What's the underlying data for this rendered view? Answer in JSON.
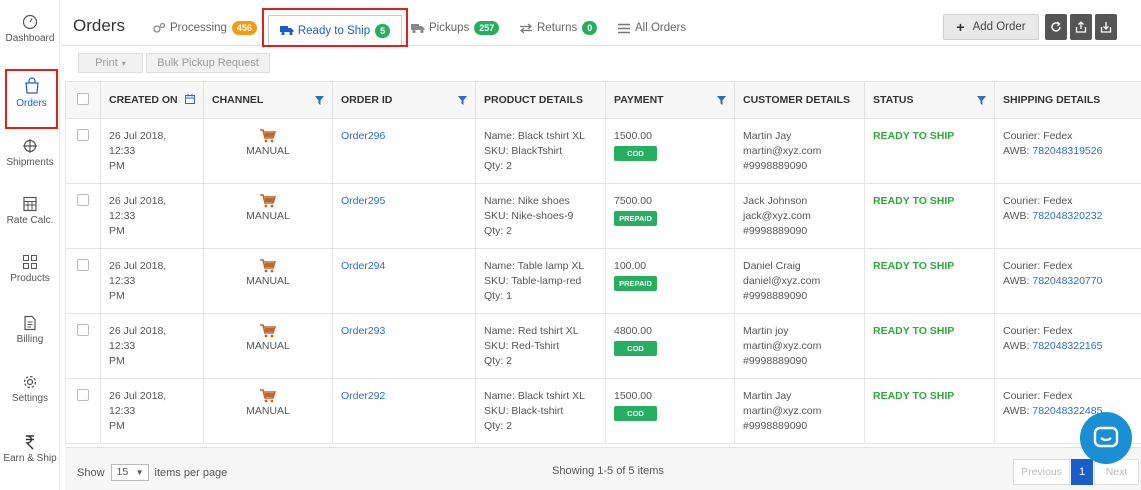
{
  "sidebar": {
    "items": [
      {
        "label": "Dashboard",
        "icon": "dashboard-icon"
      },
      {
        "label": "Orders",
        "icon": "bag-icon"
      },
      {
        "label": "Shipments",
        "icon": "crosshair-icon"
      },
      {
        "label": "Rate Calc.",
        "icon": "calculator-icon"
      },
      {
        "label": "Products",
        "icon": "grid-icon"
      },
      {
        "label": "Billing",
        "icon": "document-icon"
      },
      {
        "label": "Settings",
        "icon": "gear-icon"
      },
      {
        "label": "Earn & Ship",
        "icon": "rupee-icon"
      }
    ]
  },
  "header": {
    "title": "Orders",
    "tabs": [
      {
        "label": "Processing",
        "count": "456",
        "icon": "gears-icon"
      },
      {
        "label": "Ready to Ship",
        "count": "5",
        "icon": "truck-icon"
      },
      {
        "label": "Pickups",
        "count": "257",
        "icon": "truck-icon"
      },
      {
        "label": "Returns",
        "count": "0",
        "icon": "arrows-icon"
      },
      {
        "label": "All Orders",
        "icon": "list-icon"
      }
    ],
    "add_order": "Add Order"
  },
  "toolbar": {
    "print": "Print",
    "bulk_pickup": "Bulk Pickup Request"
  },
  "table": {
    "columns": [
      "CREATED ON",
      "CHANNEL",
      "ORDER ID",
      "PRODUCT DETAILS",
      "PAYMENT",
      "CUSTOMER DETAILS",
      "STATUS",
      "SHIPPING DETAILS"
    ],
    "rows": [
      {
        "date1": "26 Jul 2018, 12:33",
        "date2": "PM",
        "channel": "MANUAL",
        "order_id": "Order296",
        "product_name": "Name: Black tshirt XL",
        "sku": "SKU: BlackTshirt",
        "qty": "Qty: 2",
        "amount": "1500.00",
        "pay_type": "COD",
        "customer_name": "Martin Jay",
        "email": "martin@xyz.com",
        "phone": "#9998889090",
        "status": "READY TO SHIP",
        "courier": "Courier: Fedex",
        "awb_label": "AWB: ",
        "awb": "782048319526"
      },
      {
        "date1": "26 Jul 2018, 12:33",
        "date2": "PM",
        "channel": "MANUAL",
        "order_id": "Order295",
        "product_name": "Name: Nike shoes",
        "sku": "SKU: Nike-shoes-9",
        "qty": "Qty: 2",
        "amount": "7500.00",
        "pay_type": "PREPAID",
        "customer_name": "Jack Johnson",
        "email": "jack@xyz.com",
        "phone": "#9998889090",
        "status": "READY TO SHIP",
        "courier": "Courier: Fedex",
        "awb_label": "AWB: ",
        "awb": "782048320232"
      },
      {
        "date1": "26 Jul 2018, 12:33",
        "date2": "PM",
        "channel": "MANUAL",
        "order_id": "Order294",
        "product_name": "Name: Table lamp XL",
        "sku": "SKU: Table-lamp-red",
        "qty": "Qty: 1",
        "amount": "100.00",
        "pay_type": "PREPAID",
        "customer_name": "Daniel Craig",
        "email": "daniel@xyz.com",
        "phone": "#9998889090",
        "status": "READY TO SHIP",
        "courier": "Courier: Fedex",
        "awb_label": "AWB: ",
        "awb": "782048320770"
      },
      {
        "date1": "26 Jul 2018, 12:33",
        "date2": "PM",
        "channel": "MANUAL",
        "order_id": "Order293",
        "product_name": "Name: Red tshirt XL",
        "sku": "SKU: Red-Tshirt",
        "qty": "Qty: 2",
        "amount": "4800.00",
        "pay_type": "COD",
        "customer_name": "Martin joy",
        "email": "martin@xyz.com",
        "phone": "#9998889090",
        "status": "READY TO SHIP",
        "courier": "Courier: Fedex",
        "awb_label": "AWB: ",
        "awb": "782048322165"
      },
      {
        "date1": "26 Jul 2018, 12:33",
        "date2": "PM",
        "channel": "MANUAL",
        "order_id": "Order292",
        "product_name": "Name: Black tshirt XL",
        "sku": "SKU: Black-tshirt",
        "qty": "Qty: 2",
        "amount": "1500.00",
        "pay_type": "COD",
        "customer_name": "Martin Jay",
        "email": "martin@xyz.com",
        "phone": "#9998889090",
        "status": "READY TO SHIP",
        "courier": "Courier: Fedex",
        "awb_label": "AWB: ",
        "awb": "782048322485"
      }
    ]
  },
  "footer": {
    "show": "Show",
    "per_page": "15",
    "items_per_page": "items per page",
    "showing": "Showing 1-5 of 5 items",
    "previous": "Previous",
    "page": "1",
    "next": "Next"
  },
  "colors": {
    "accent": "#1a5fc9",
    "status_green": "#2eaa3a",
    "badge_orange": "#f39c12",
    "highlight_red": "#e0201c"
  }
}
